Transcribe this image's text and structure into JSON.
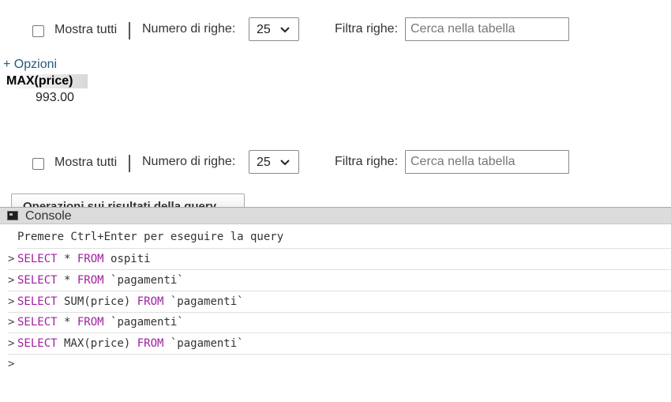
{
  "navigation": {
    "show_all_label": "Mostra tutti",
    "rows_label": "Numero di righe:",
    "rows_value": "25",
    "filter_label": "Filtra righe:",
    "filter_placeholder": "Cerca nella tabella"
  },
  "results": {
    "options_link": "+ Opzioni",
    "column_header": "MAX(price)",
    "cell_value": "993.00"
  },
  "query_ops_tab": "Operazioni sui risultati della query",
  "console": {
    "title": "Console",
    "hint": "Premere Ctrl+Enter per eseguire la query",
    "caret": ">",
    "history": [
      {
        "kw1": "SELECT",
        "mid": " * ",
        "kw2": "FROM",
        "tail": " ospiti"
      },
      {
        "kw1": "SELECT",
        "mid": " * ",
        "kw2": "FROM",
        "tail": " `pagamenti`"
      },
      {
        "kw1": "SELECT",
        "mid": " SUM(price) ",
        "kw2": "FROM",
        "tail": " `pagamenti`"
      },
      {
        "kw1": "SELECT",
        "mid": " * ",
        "kw2": "FROM",
        "tail": " `pagamenti`"
      },
      {
        "kw1": "SELECT",
        "mid": " MAX(price) ",
        "kw2": "FROM",
        "tail": " `pagamenti`"
      }
    ]
  }
}
